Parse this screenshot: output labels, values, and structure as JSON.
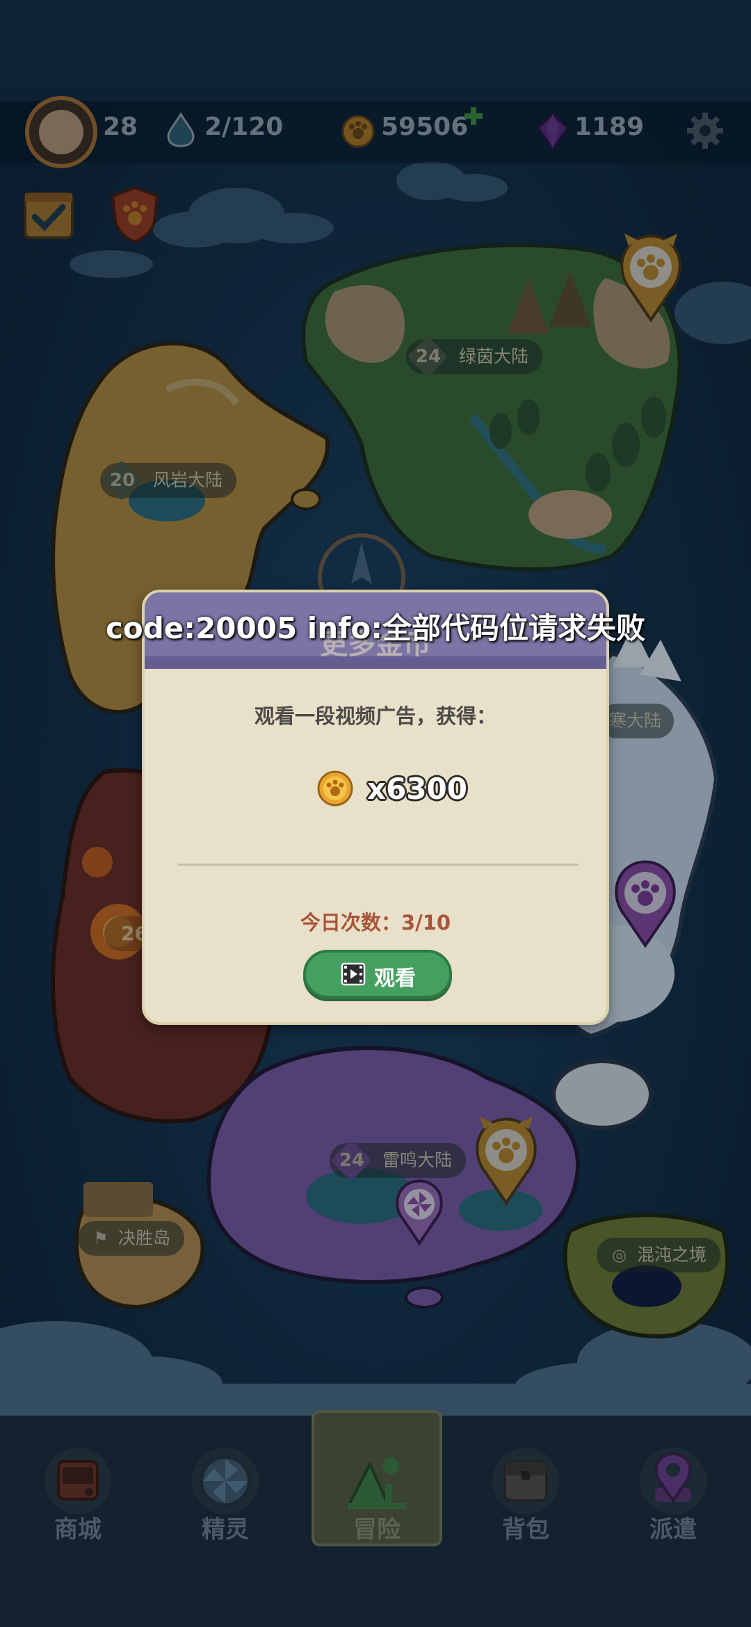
{
  "hud": {
    "player_level": "28",
    "energy": "2/120",
    "coins": "59506",
    "gems": "1189",
    "coin_plus_icon": "plus-icon",
    "settings_icon": "gear-icon"
  },
  "map": {
    "regions": [
      {
        "level": "24",
        "name": "绿茵大陆"
      },
      {
        "level": "20",
        "name": "风岩大陆"
      },
      {
        "level": "",
        "name": "寒大陆"
      },
      {
        "level": "26",
        "name": ""
      },
      {
        "level": "24",
        "name": "雷鸣大陆"
      }
    ],
    "special": [
      {
        "name": "决胜岛",
        "icon": "flag-icon"
      },
      {
        "name": "混沌之境",
        "icon": "swirl-icon"
      }
    ]
  },
  "dialog": {
    "title": "更多金币",
    "description": "观看一段视频广告，获得：",
    "reward": "x6300",
    "daily_count": "今日次数：3/10",
    "watch_button": "观看"
  },
  "toast": {
    "error": "code:20005 info:全部代码位请求失败"
  },
  "bottom_nav": {
    "items": [
      {
        "label": "商城",
        "icon": "shop-icon"
      },
      {
        "label": "精灵",
        "icon": "spirit-icon"
      },
      {
        "label": "冒险",
        "icon": "adventure-icon"
      },
      {
        "label": "背包",
        "icon": "backpack-icon"
      },
      {
        "label": "派遣",
        "icon": "dispatch-icon"
      }
    ]
  },
  "colors": {
    "ocean": "#0f2a40",
    "dialog_bg": "#e8e0c8",
    "dialog_header": "#7b74a4",
    "button_green": "#45a060",
    "count_text": "#a8553a"
  }
}
